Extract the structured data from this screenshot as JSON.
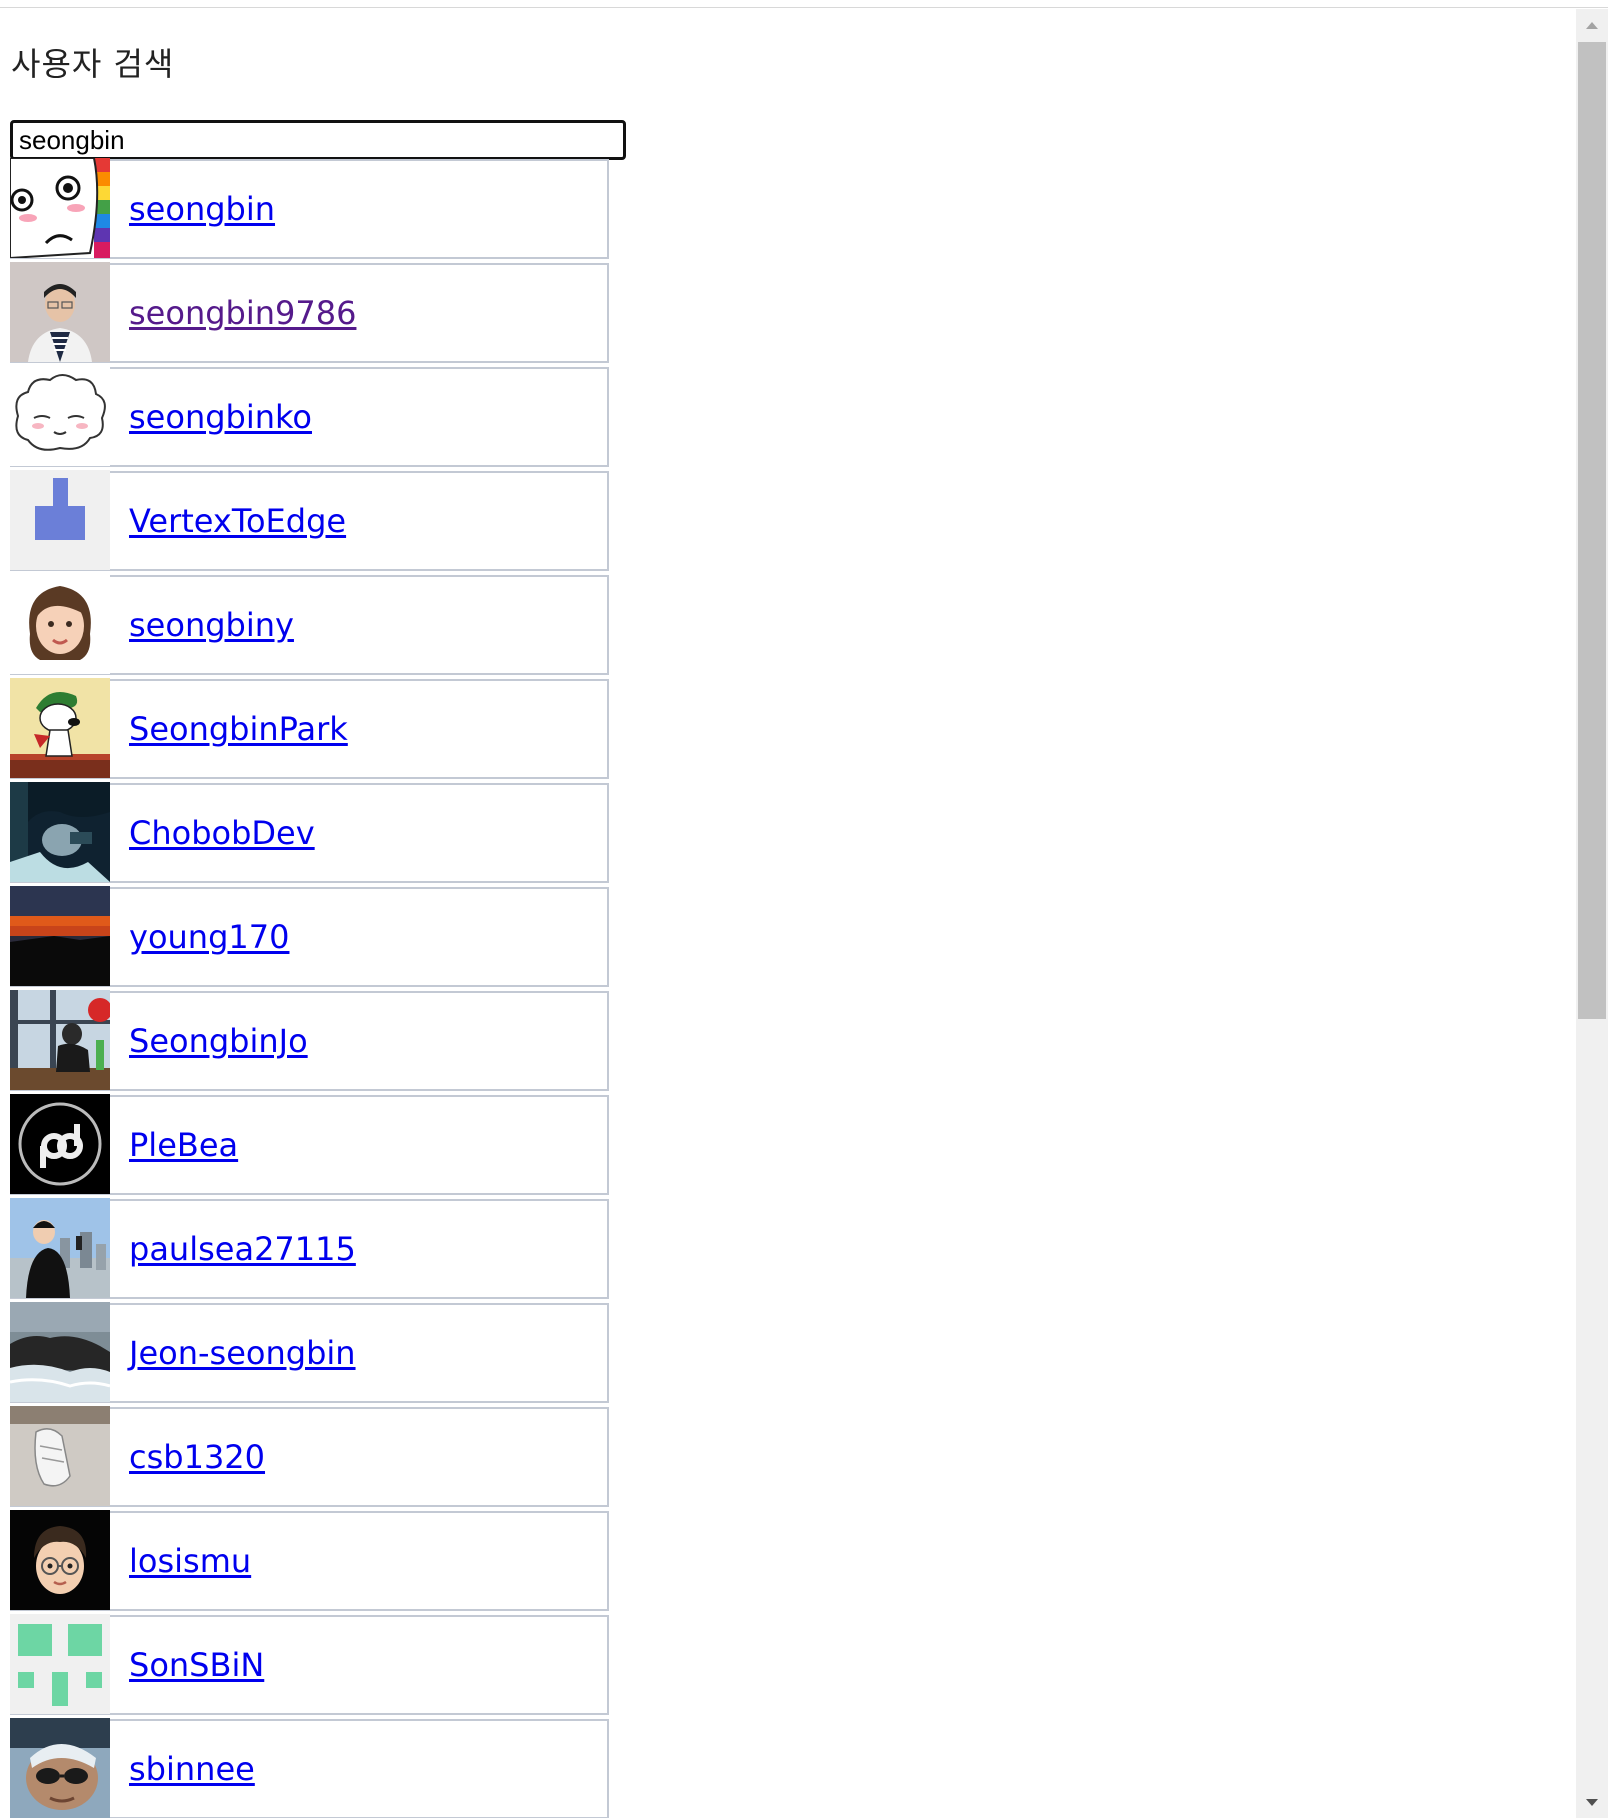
{
  "page": {
    "title": "사용자 검색"
  },
  "search": {
    "value": "seongbin"
  },
  "results": [
    {
      "username": "seongbin",
      "avatar": "cartoon-face-avatar",
      "visited": false
    },
    {
      "username": "seongbin9786",
      "avatar": "person-photo-avatar",
      "visited": true
    },
    {
      "username": "seongbinko",
      "avatar": "sketch-sheep-avatar",
      "visited": false
    },
    {
      "username": "VertexToEdge",
      "avatar": "identicon-avatar",
      "visited": false
    },
    {
      "username": "seongbiny",
      "avatar": "memoji-avatar",
      "visited": false
    },
    {
      "username": "SeongbinPark",
      "avatar": "snoopy-avatar",
      "visited": false
    },
    {
      "username": "ChobobDev",
      "avatar": "photo-avatar",
      "visited": false
    },
    {
      "username": "young170",
      "avatar": "sunset-photo-avatar",
      "visited": false
    },
    {
      "username": "SeongbinJo",
      "avatar": "person-window-photo-avatar",
      "visited": false
    },
    {
      "username": "PleBea",
      "avatar": "pb-logo-avatar",
      "visited": false
    },
    {
      "username": "paulsea27115",
      "avatar": "person-selfie-avatar",
      "visited": false
    },
    {
      "username": "Jeon-seongbin",
      "avatar": "rock-sea-photo-avatar",
      "visited": false
    },
    {
      "username": "csb1320",
      "avatar": "shoe-photo-avatar",
      "visited": false
    },
    {
      "username": "losismu",
      "avatar": "memoji-glasses-avatar",
      "visited": false
    },
    {
      "username": "SonSBiN",
      "avatar": "green-identicon-avatar",
      "visited": false
    },
    {
      "username": "sbinnee",
      "avatar": "person-sunglasses-avatar",
      "visited": false
    }
  ],
  "colors": {
    "link": "#0000ee",
    "visited_link": "#551a8b",
    "row_border": "#c3c9d4"
  }
}
